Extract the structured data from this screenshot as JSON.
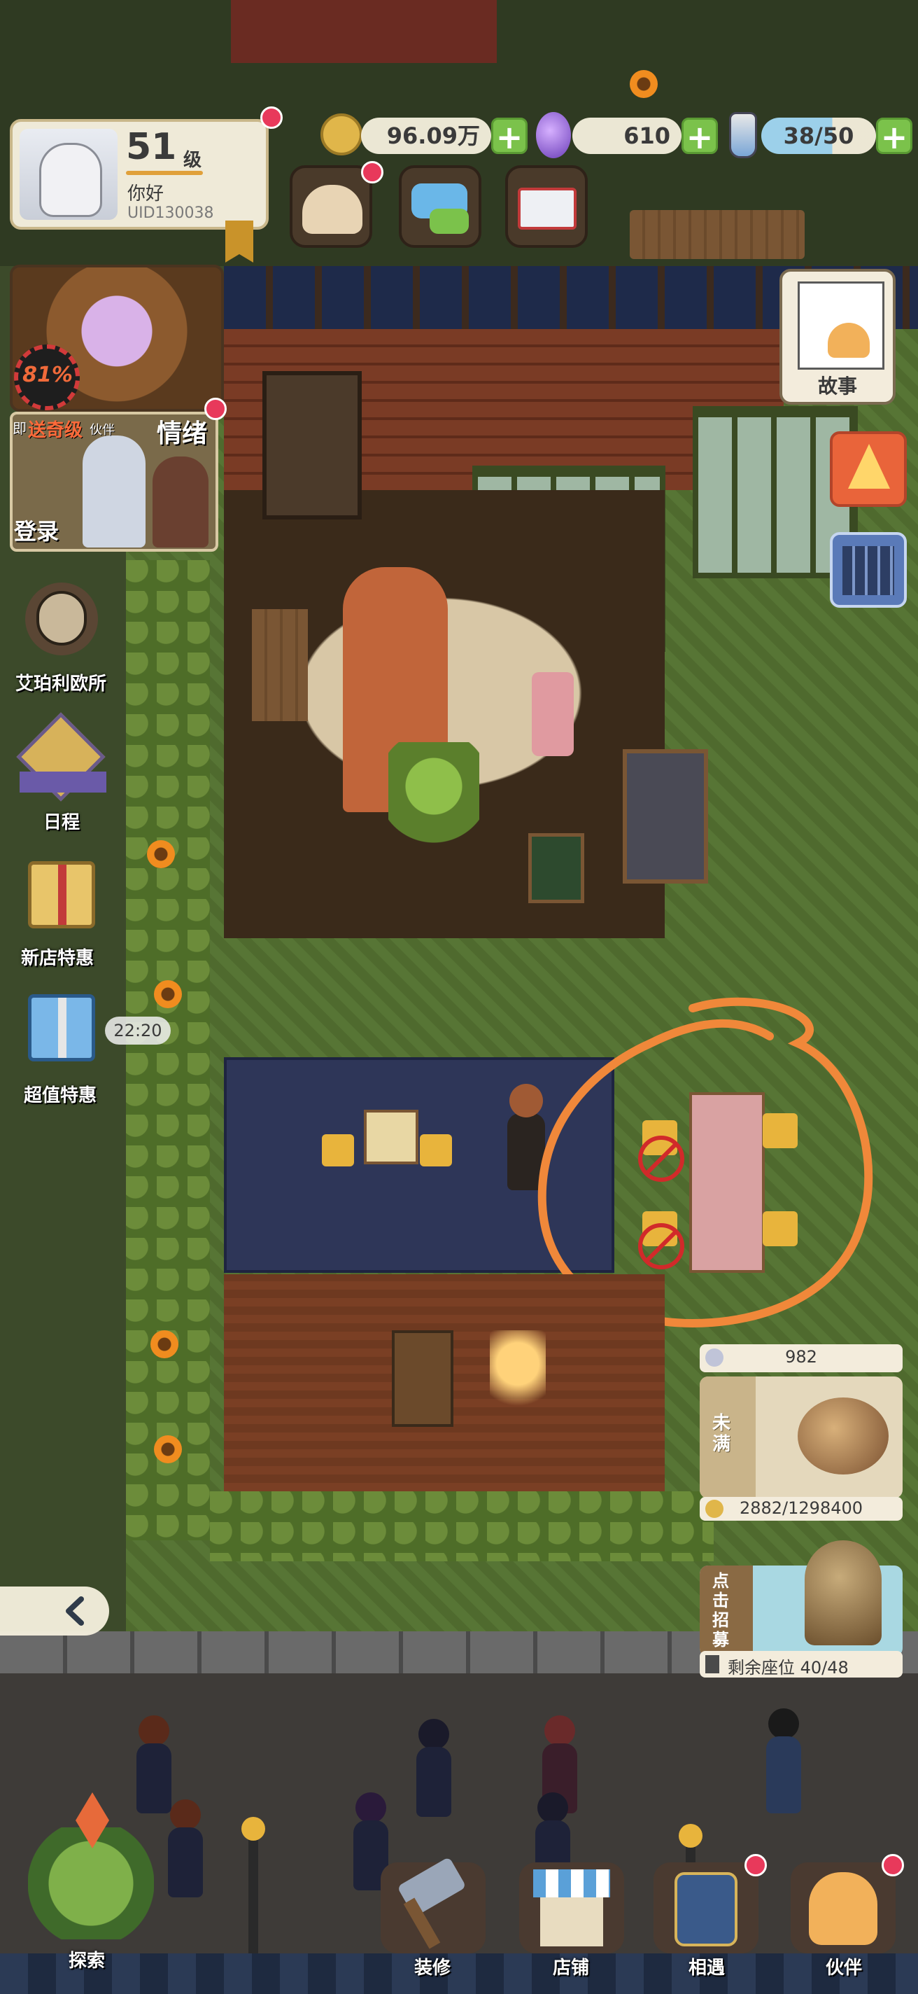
{
  "profile": {
    "level_number": "51",
    "level_suffix": "级",
    "name": "你好",
    "uid": "UID130038",
    "progress_percent": "81%"
  },
  "currencies": {
    "coins": "96.09万",
    "gems": "610",
    "energy": "38/50"
  },
  "top_icons": {
    "cats_badge": "",
    "story_label": "故事"
  },
  "banner": {
    "prefix": "即",
    "promo": "送奇级",
    "promo_small": "伙伴",
    "side": "情绪",
    "login": "登录"
  },
  "left_menu": [
    {
      "label": "艾珀利欧所",
      "icon": "owl-icon"
    },
    {
      "label": "日程",
      "icon": "schedule-badge-icon"
    },
    {
      "label": "新店特惠",
      "icon": "gift-box-icon"
    },
    {
      "label": "超值特惠",
      "icon": "blue-gift-icon",
      "timer": "22:20"
    }
  ],
  "right_panel": {
    "gem_count": "982",
    "status_label": "未满",
    "coin_progress": "2882/1298400",
    "recruit_label": "点击招募",
    "seats": "剩余座位 40/48"
  },
  "bottom_nav": [
    {
      "label": "探索",
      "icon": "explore-icon"
    },
    {
      "label": "装修",
      "icon": "hammer-icon"
    },
    {
      "label": "店铺",
      "icon": "shop-icon"
    },
    {
      "label": "相遇",
      "icon": "phone-icon"
    },
    {
      "label": "伙伴",
      "icon": "cat-partner-icon"
    }
  ],
  "colors": {
    "plus_green": "#7bc24b",
    "highlight_orange": "#f0883a",
    "badge_red": "#e8395b"
  }
}
